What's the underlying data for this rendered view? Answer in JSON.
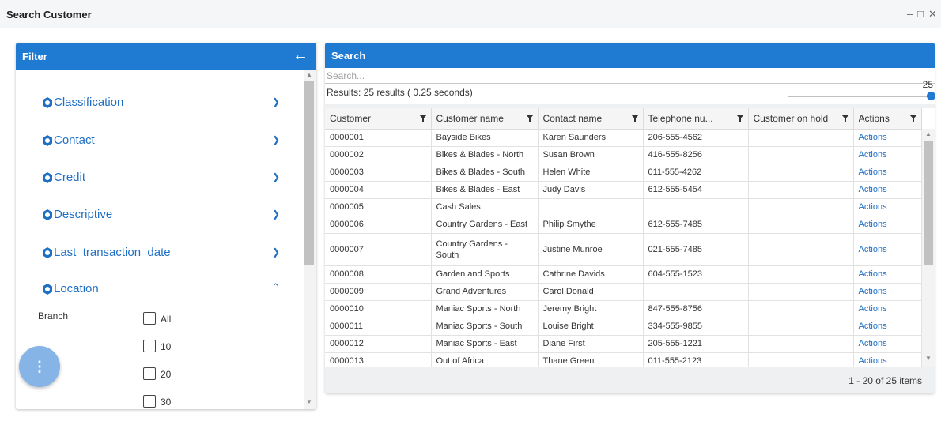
{
  "window": {
    "title": "Search Customer",
    "controls": {
      "minimize": "–",
      "maximize": "□",
      "close": "✕"
    }
  },
  "filter": {
    "title": "Filter",
    "back_icon": "arrow-left-icon",
    "groups": [
      {
        "name": "Classification",
        "expanded": false
      },
      {
        "name": "Contact",
        "expanded": false
      },
      {
        "name": "Credit",
        "expanded": false
      },
      {
        "name": "Descriptive",
        "expanded": false
      },
      {
        "name": "Last_transaction_date",
        "expanded": false
      },
      {
        "name": "Location",
        "expanded": true
      }
    ],
    "branch": {
      "label": "Branch",
      "options": [
        "All",
        "10",
        "20",
        "30"
      ]
    },
    "fab_icon": "more-vert-icon"
  },
  "search": {
    "title": "Search",
    "placeholder": "Search...",
    "results_text": "Results: 25 results ( 0.25 seconds)",
    "page_size": "25",
    "columns": [
      "Customer",
      "Customer name",
      "Contact name",
      "Telephone nu...",
      "Customer on hold",
      "Actions"
    ],
    "rows": [
      [
        "0000001",
        "Bayside Bikes",
        "Karen Saunders",
        "206-555-4562",
        "",
        "Actions"
      ],
      [
        "0000002",
        "Bikes & Blades - North",
        "Susan Brown",
        "416-555-8256",
        "",
        "Actions"
      ],
      [
        "0000003",
        "Bikes & Blades - South",
        "Helen White",
        "011-555-4262",
        "",
        "Actions"
      ],
      [
        "0000004",
        "Bikes & Blades - East",
        "Judy Davis",
        "612-555-5454",
        "",
        "Actions"
      ],
      [
        "0000005",
        "Cash Sales",
        "",
        "",
        "",
        "Actions"
      ],
      [
        "0000006",
        "Country Gardens - East",
        "Philip Smythe",
        "612-555-7485",
        "",
        "Actions"
      ],
      [
        "0000007",
        "Country Gardens - South",
        "Justine Munroe",
        "021-555-7485",
        "",
        "Actions"
      ],
      [
        "0000008",
        "Garden and Sports",
        "Cathrine Davids",
        "604-555-1523",
        "",
        "Actions"
      ],
      [
        "0000009",
        "Grand Adventures",
        "Carol Donald",
        "",
        "",
        "Actions"
      ],
      [
        "0000010",
        "Maniac Sports - North",
        "Jeremy Bright",
        "847-555-8756",
        "",
        "Actions"
      ],
      [
        "0000011",
        "Maniac Sports - South",
        "Louise Bright",
        "334-555-9855",
        "",
        "Actions"
      ],
      [
        "0000012",
        "Maniac Sports - East",
        "Diane First",
        "205-555-1221",
        "",
        "Actions"
      ],
      [
        "0000013",
        "Out of Africa",
        "Thane Green",
        "011-555-2123",
        "",
        "Actions"
      ]
    ],
    "pager_text": "1 - 20 of 25 items"
  },
  "colors": {
    "accent": "#1f7ad2",
    "link": "#1f6fc4",
    "fab": "#86b4e6"
  }
}
